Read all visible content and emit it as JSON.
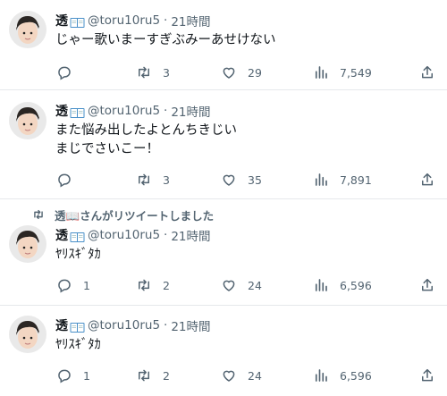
{
  "tweets": [
    {
      "display_name": "透",
      "handle": "@toru10ru5",
      "separator": "·",
      "time": "21時間",
      "lines": [
        "じゃー歌いまーすぎぶみーあせけない"
      ],
      "retweet_banner": "",
      "replies": "",
      "retweets": "3",
      "likes": "29",
      "views": "7,549"
    },
    {
      "display_name": "透",
      "handle": "@toru10ru5",
      "separator": "·",
      "time": "21時間",
      "lines": [
        "また悩み出したよとんちきじい",
        "まじでさいこー！"
      ],
      "retweet_banner": "",
      "replies": "",
      "retweets": "3",
      "likes": "35",
      "views": "7,891"
    },
    {
      "display_name": "透",
      "handle": "@toru10ru5",
      "separator": "·",
      "time": "21時間",
      "lines": [
        "ﾔﾘｽｷﾞﾀｶ"
      ],
      "retweet_banner": "透📖さんがリツイートしました",
      "replies": "1",
      "retweets": "2",
      "likes": "24",
      "views": "6,596"
    },
    {
      "display_name": "透",
      "handle": "@toru10ru5",
      "separator": "·",
      "time": "21時間",
      "lines": [
        "ﾔﾘｽｷﾞﾀｶ"
      ],
      "retweet_banner": "",
      "replies": "1",
      "retweets": "2",
      "likes": "24",
      "views": "6,596"
    }
  ],
  "icons": {
    "reply": "reply-icon",
    "retweet": "retweet-icon",
    "like": "heart-icon",
    "views": "views-icon",
    "share": "share-icon",
    "book": "open-book-emoji-icon"
  },
  "colors": {
    "text": "#0f1419",
    "secondary": "#536471",
    "divider": "#e6e8eb"
  }
}
